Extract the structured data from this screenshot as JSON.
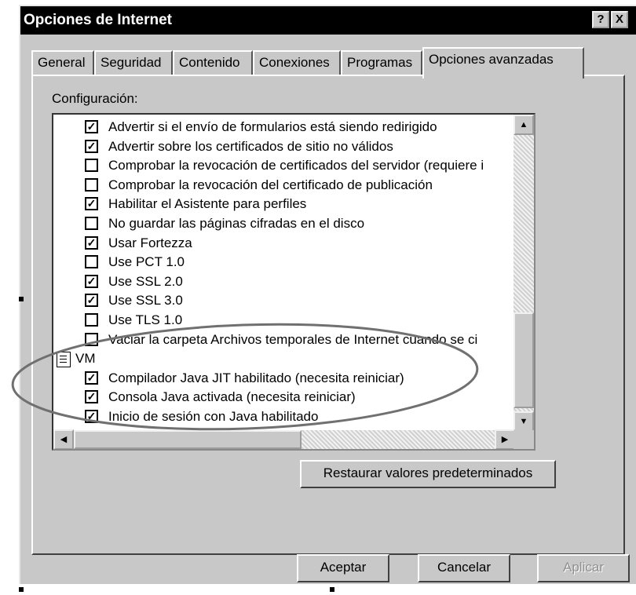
{
  "window": {
    "title": "Opciones de Internet",
    "help_glyph": "?",
    "close_glyph": "X"
  },
  "tabs": [
    {
      "label": "General"
    },
    {
      "label": "Seguridad"
    },
    {
      "label": "Contenido"
    },
    {
      "label": "Conexiones"
    },
    {
      "label": "Programas"
    },
    {
      "label": "Opciones avanzadas",
      "active": true
    }
  ],
  "settings": {
    "section_label": "Configuración:",
    "items": [
      {
        "label": "Advertir si el envío de formularios está siendo redirigido",
        "checked": true
      },
      {
        "label": "Advertir sobre los certificados de sitio no válidos",
        "checked": true
      },
      {
        "label": "Comprobar la revocación de certificados del servidor (requiere i",
        "checked": false
      },
      {
        "label": "Comprobar la revocación del certificado de publicación",
        "checked": false
      },
      {
        "label": "Habilitar el Asistente para perfiles",
        "checked": true
      },
      {
        "label": "No guardar las páginas cifradas en el disco",
        "checked": false
      },
      {
        "label": "Usar Fortezza",
        "checked": true
      },
      {
        "label": "Use PCT 1.0",
        "checked": false
      },
      {
        "label": "Use SSL 2.0",
        "checked": true
      },
      {
        "label": "Use SSL 3.0",
        "checked": true
      },
      {
        "label": "Use TLS 1.0",
        "checked": false
      },
      {
        "label": "Vaciar la carpeta Archivos temporales de Internet cuando se ci",
        "checked": false
      },
      {
        "label": "VM",
        "group": true
      },
      {
        "label": "Compilador Java JIT habilitado (necesita reiniciar)",
        "checked": true
      },
      {
        "label": "Consola Java activada (necesita reiniciar)",
        "checked": true
      },
      {
        "label": "Inicio de sesión con Java habilitado",
        "checked": true
      }
    ]
  },
  "buttons": {
    "restore": "Restaurar valores predeterminados",
    "ok": "Aceptar",
    "cancel": "Cancelar",
    "apply": "Aplicar"
  },
  "colors": {
    "titlebar": "#000000",
    "face": "#c8c8c8",
    "annotation_ellipse": "#707070"
  }
}
